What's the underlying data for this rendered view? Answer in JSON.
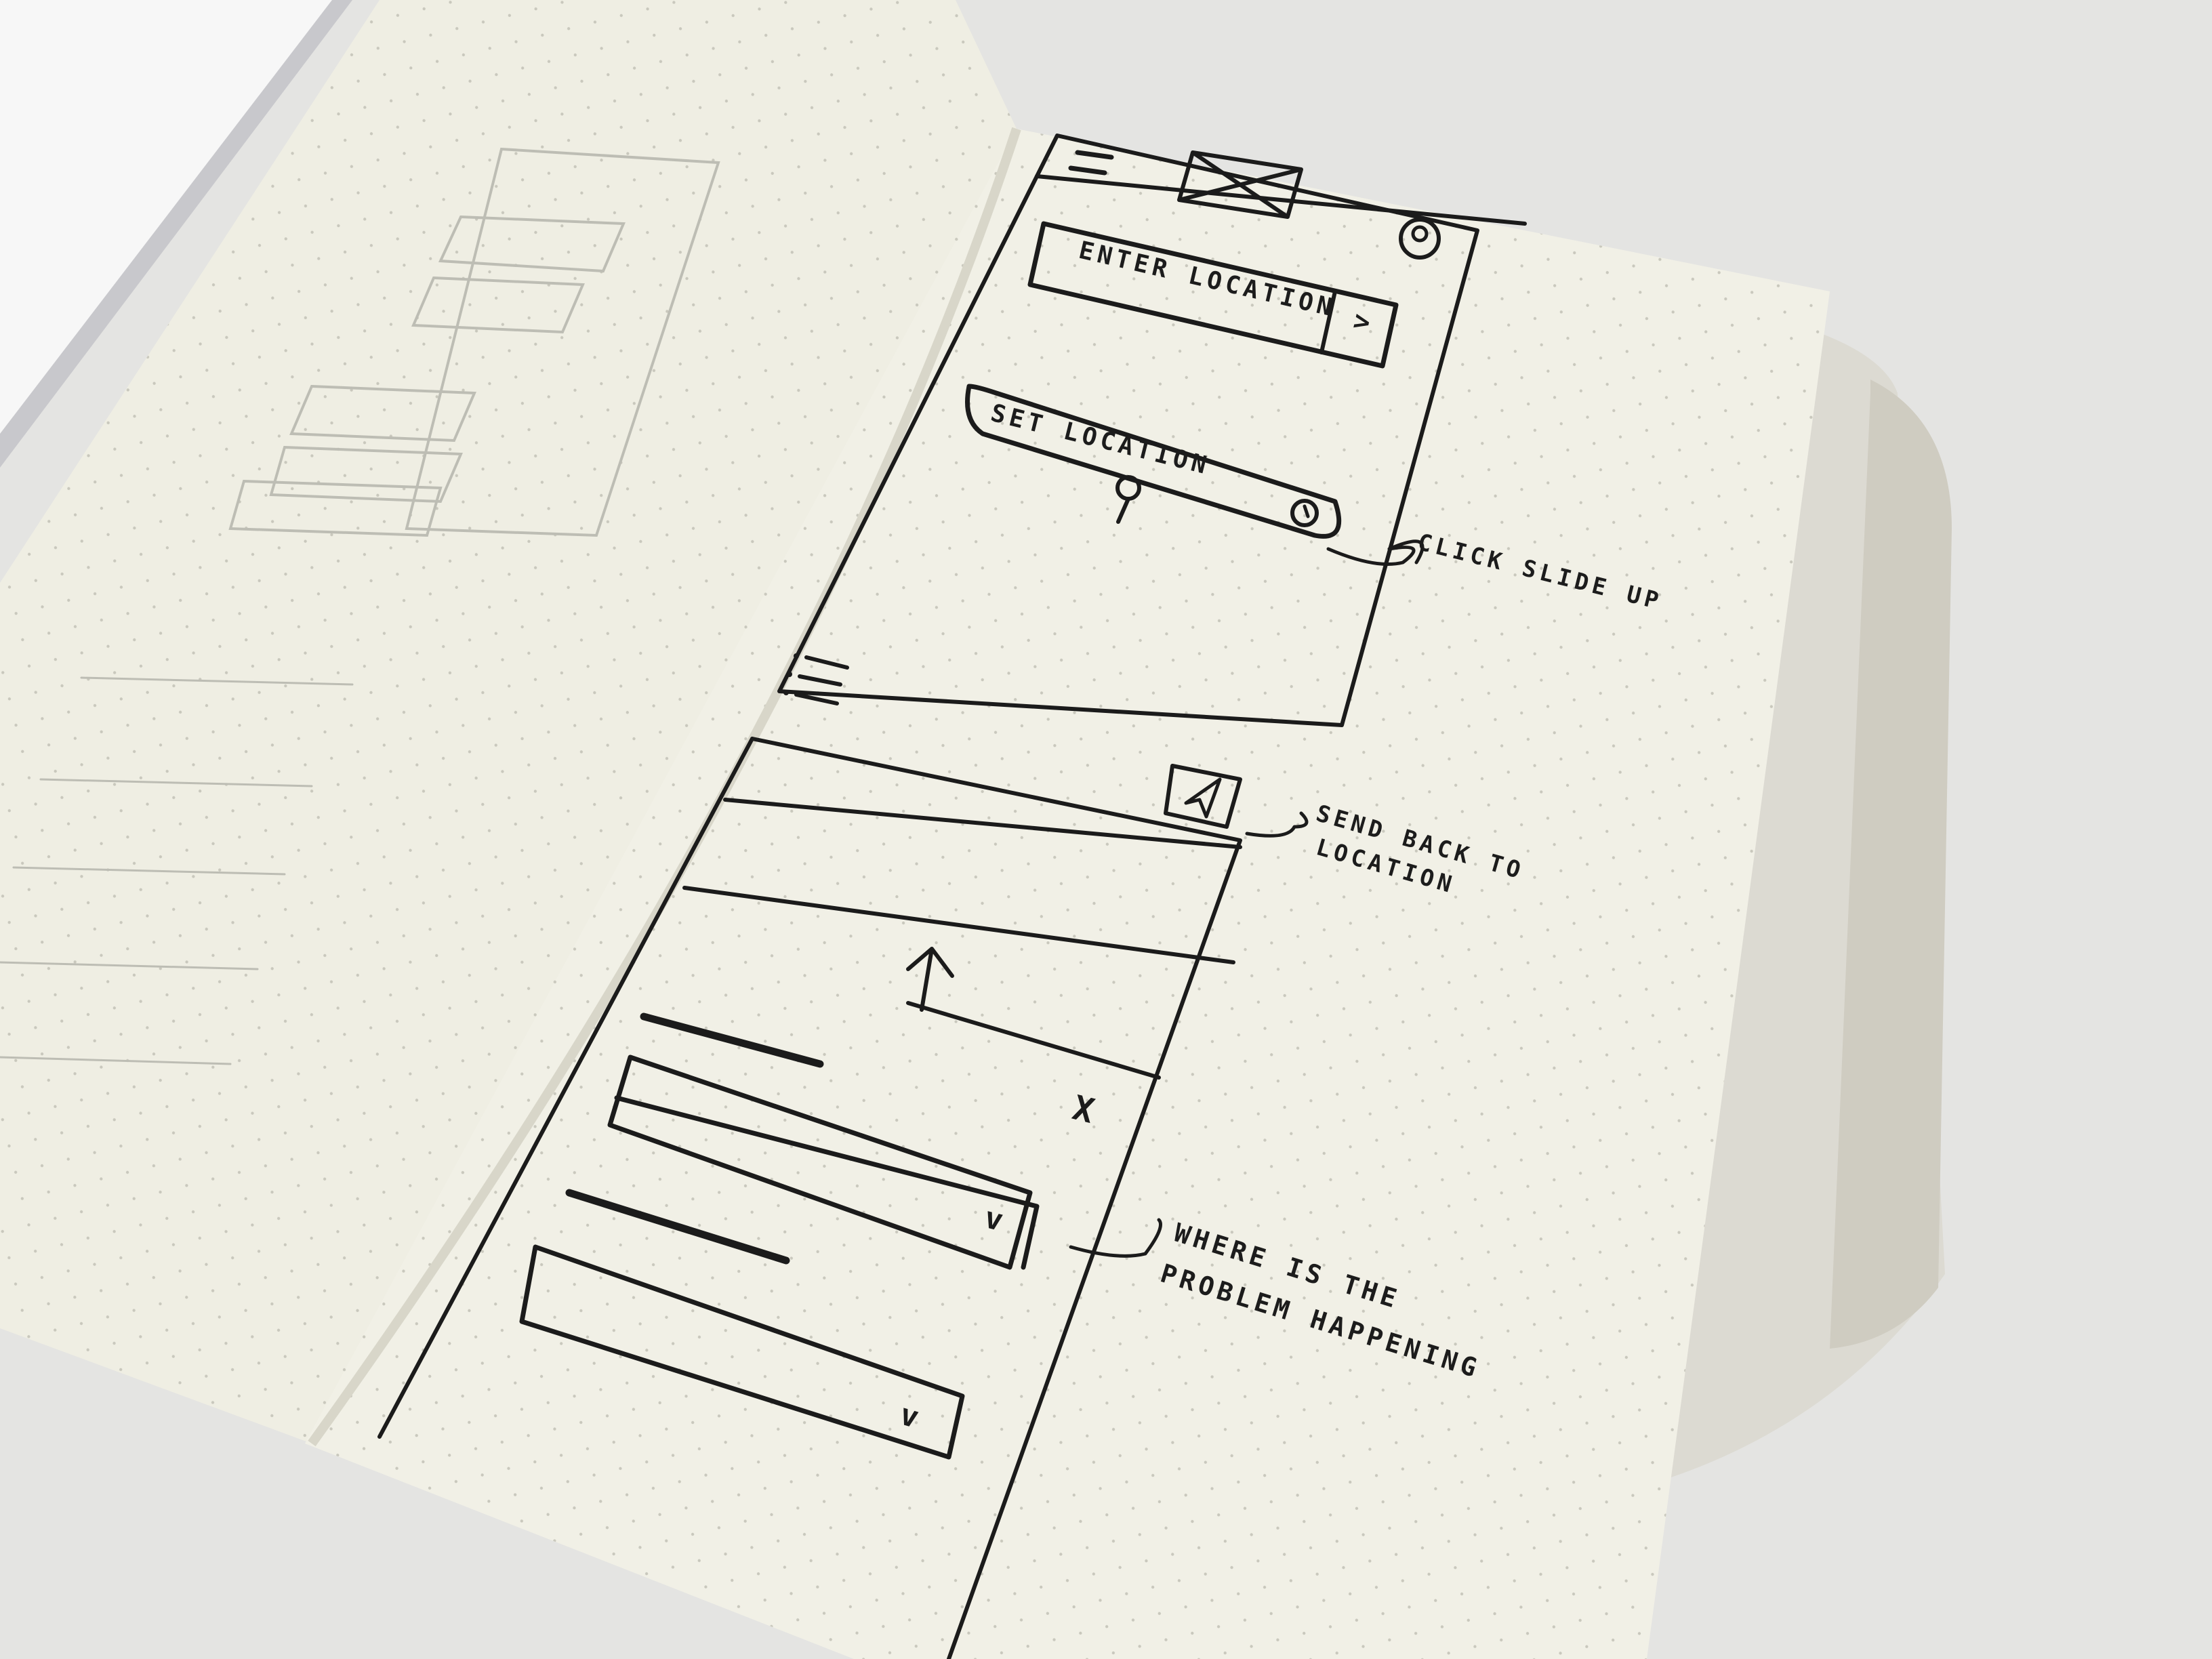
{
  "phone_sketch": {
    "search_placeholder": "ENTER LOCATION",
    "search_go": ">",
    "set_location_label": "SET LOCATION",
    "list_close": "X",
    "dropdown_1_chevron": "v",
    "dropdown_2_chevron": "v"
  },
  "annotations": {
    "click_slide_up": "CLICK SLIDE UP",
    "send_back_line1": "SEND BACK TO",
    "send_back_line2": "LOCATION",
    "where_line1": "WHERE IS THE",
    "where_line2": "PROBLEM HAPPENING"
  },
  "icons": [
    "hamburger-menu-icon",
    "logo-placeholder-icon",
    "user-avatar-icon",
    "map-pin-icon",
    "locate-icon",
    "list-icon",
    "navigation-arrow-icon",
    "up-arrow-icon"
  ],
  "colors": {
    "paper": "#efeee3",
    "ink": "#1b1b1b",
    "table": "#e4e4e2"
  }
}
